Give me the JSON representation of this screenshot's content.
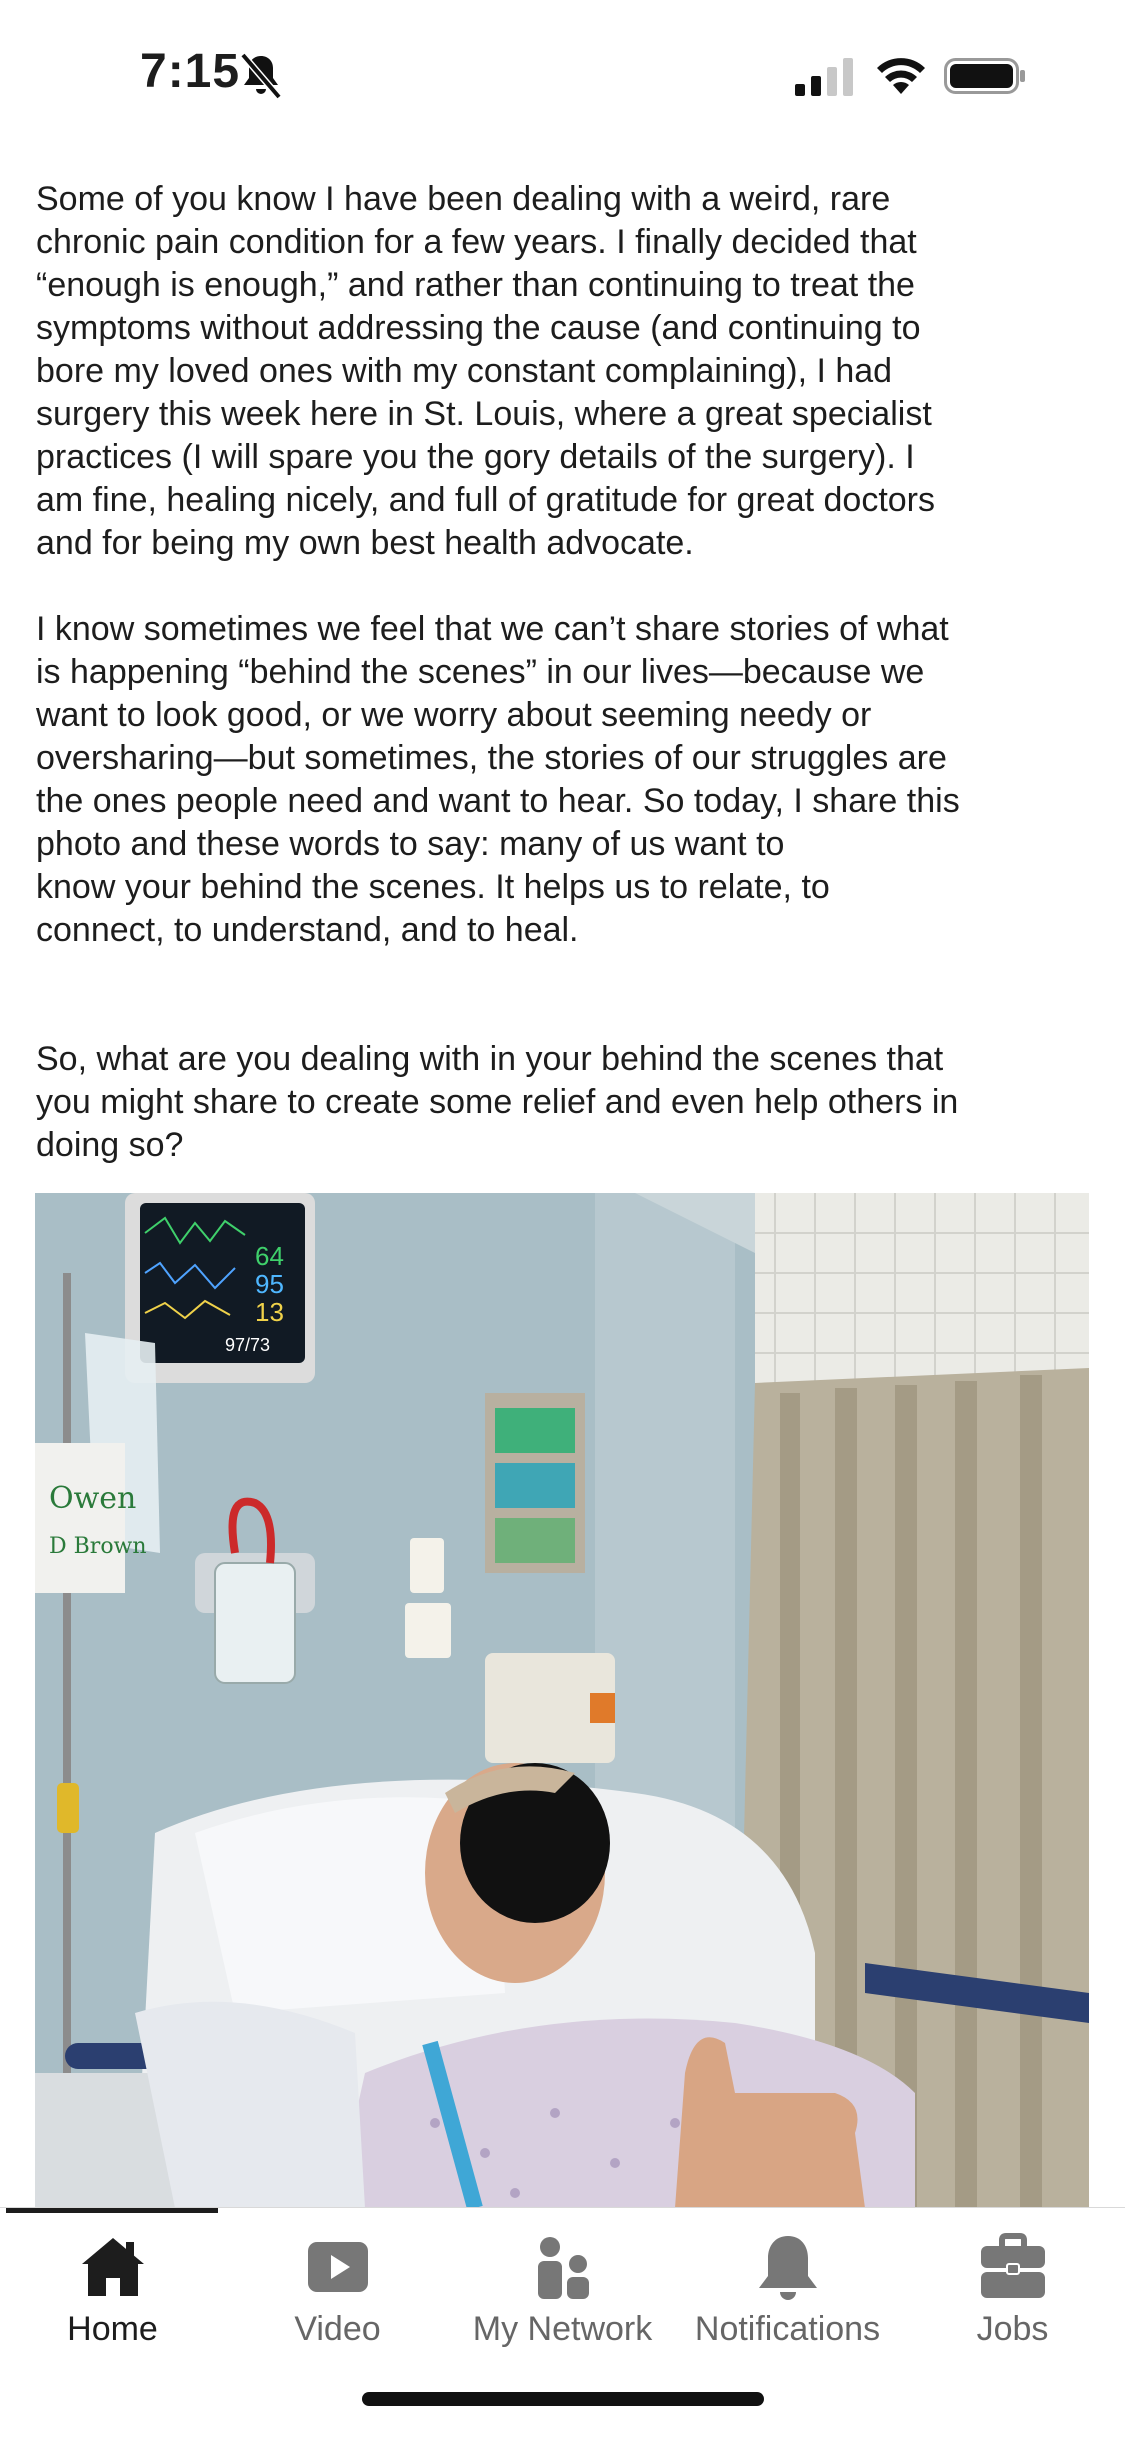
{
  "status_bar": {
    "time": "7:15",
    "icons": [
      "bell-slash-icon",
      "cellular-signal-icon",
      "wifi-icon",
      "battery-icon"
    ]
  },
  "post": {
    "paragraphs": [
      "Some of you know I have been dealing with a weird, rare\nchronic pain condition for a few years. I finally decided that\n“enough is enough,” and rather than continuing to treat the\nsymptoms without addressing the cause (and continuing to\nbore my loved ones with my constant complaining), I had\nsurgery this week here in St. Louis, where a great specialist\npractices (I will spare you the gory details of the surgery). I\nam fine, healing nicely, and full of gratitude for great doctors\nand for being my own best health advocate.",
      "I know sometimes we feel that we can’t share stories of what\nis happening “behind the scenes” in our lives—because we\nwant to look good, or we worry about seeming needy or\noversharing—but sometimes, the stories of our struggles are\nthe ones people need and want to hear. So today, I share this\nphoto and these words to say: many of us want to\nknow your behind the scenes. It helps us to relate, to\nconnect, to understand, and to heal.",
      "So, what are you dealing with in your behind the scenes that\nyou might share to create some relief and even help others in\ndoing so?"
    ],
    "photo": {
      "monitor_readings": [
        "64",
        "95",
        "13",
        "97/73"
      ],
      "whiteboard_text": [
        "Owen",
        "D Brown"
      ]
    }
  },
  "tabbar": {
    "tabs": [
      {
        "label": "Home",
        "icon": "home-icon",
        "active": true
      },
      {
        "label": "Video",
        "icon": "video-icon",
        "active": false
      },
      {
        "label": "My Network",
        "icon": "my-network-icon",
        "active": false
      },
      {
        "label": "Notifications",
        "icon": "bell-icon",
        "active": false
      },
      {
        "label": "Jobs",
        "icon": "briefcase-icon",
        "active": false
      }
    ]
  },
  "colors": {
    "text": "#1d1d1d",
    "tab_inactive": "#666666",
    "tab_icon_inactive": "#777777",
    "tab_active": "#1d1d1d"
  }
}
